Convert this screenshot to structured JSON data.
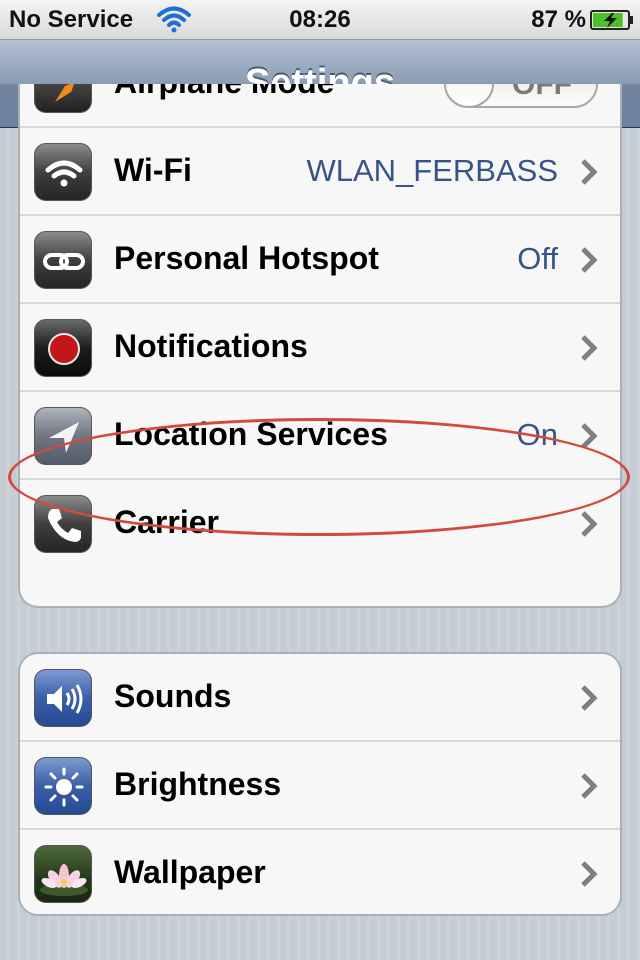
{
  "status_bar": {
    "carrier": "No Service",
    "time": "08:26",
    "battery_percent": "87 %",
    "battery_level": 0.87,
    "icons": [
      "wifi-icon",
      "battery-charging-icon"
    ]
  },
  "nav": {
    "title": "Settings"
  },
  "group1": {
    "rows": [
      {
        "label": "Airplane Mode",
        "icon": "airplane-icon",
        "control": "toggle",
        "toggle_text": "OFF"
      },
      {
        "label": "Wi-Fi",
        "value": "WLAN_FERBASS",
        "icon": "wifi-icon"
      },
      {
        "label": "Personal Hotspot",
        "value": "Off",
        "icon": "hotspot-link-icon"
      },
      {
        "label": "Notifications",
        "value": "",
        "icon": "notifications-icon"
      },
      {
        "label": "Location Services",
        "value": "On",
        "icon": "location-arrow-icon"
      },
      {
        "label": "Carrier",
        "value": "",
        "icon": "phone-icon"
      }
    ]
  },
  "group2": {
    "rows": [
      {
        "label": "Sounds",
        "icon": "speaker-icon"
      },
      {
        "label": "Brightness",
        "icon": "brightness-sun-icon"
      },
      {
        "label": "Wallpaper",
        "icon": "wallpaper-flower-icon"
      }
    ]
  },
  "colors": {
    "value_text": "#385487",
    "annotation": "#d24a3c",
    "nav_bar": "#7185a0"
  }
}
